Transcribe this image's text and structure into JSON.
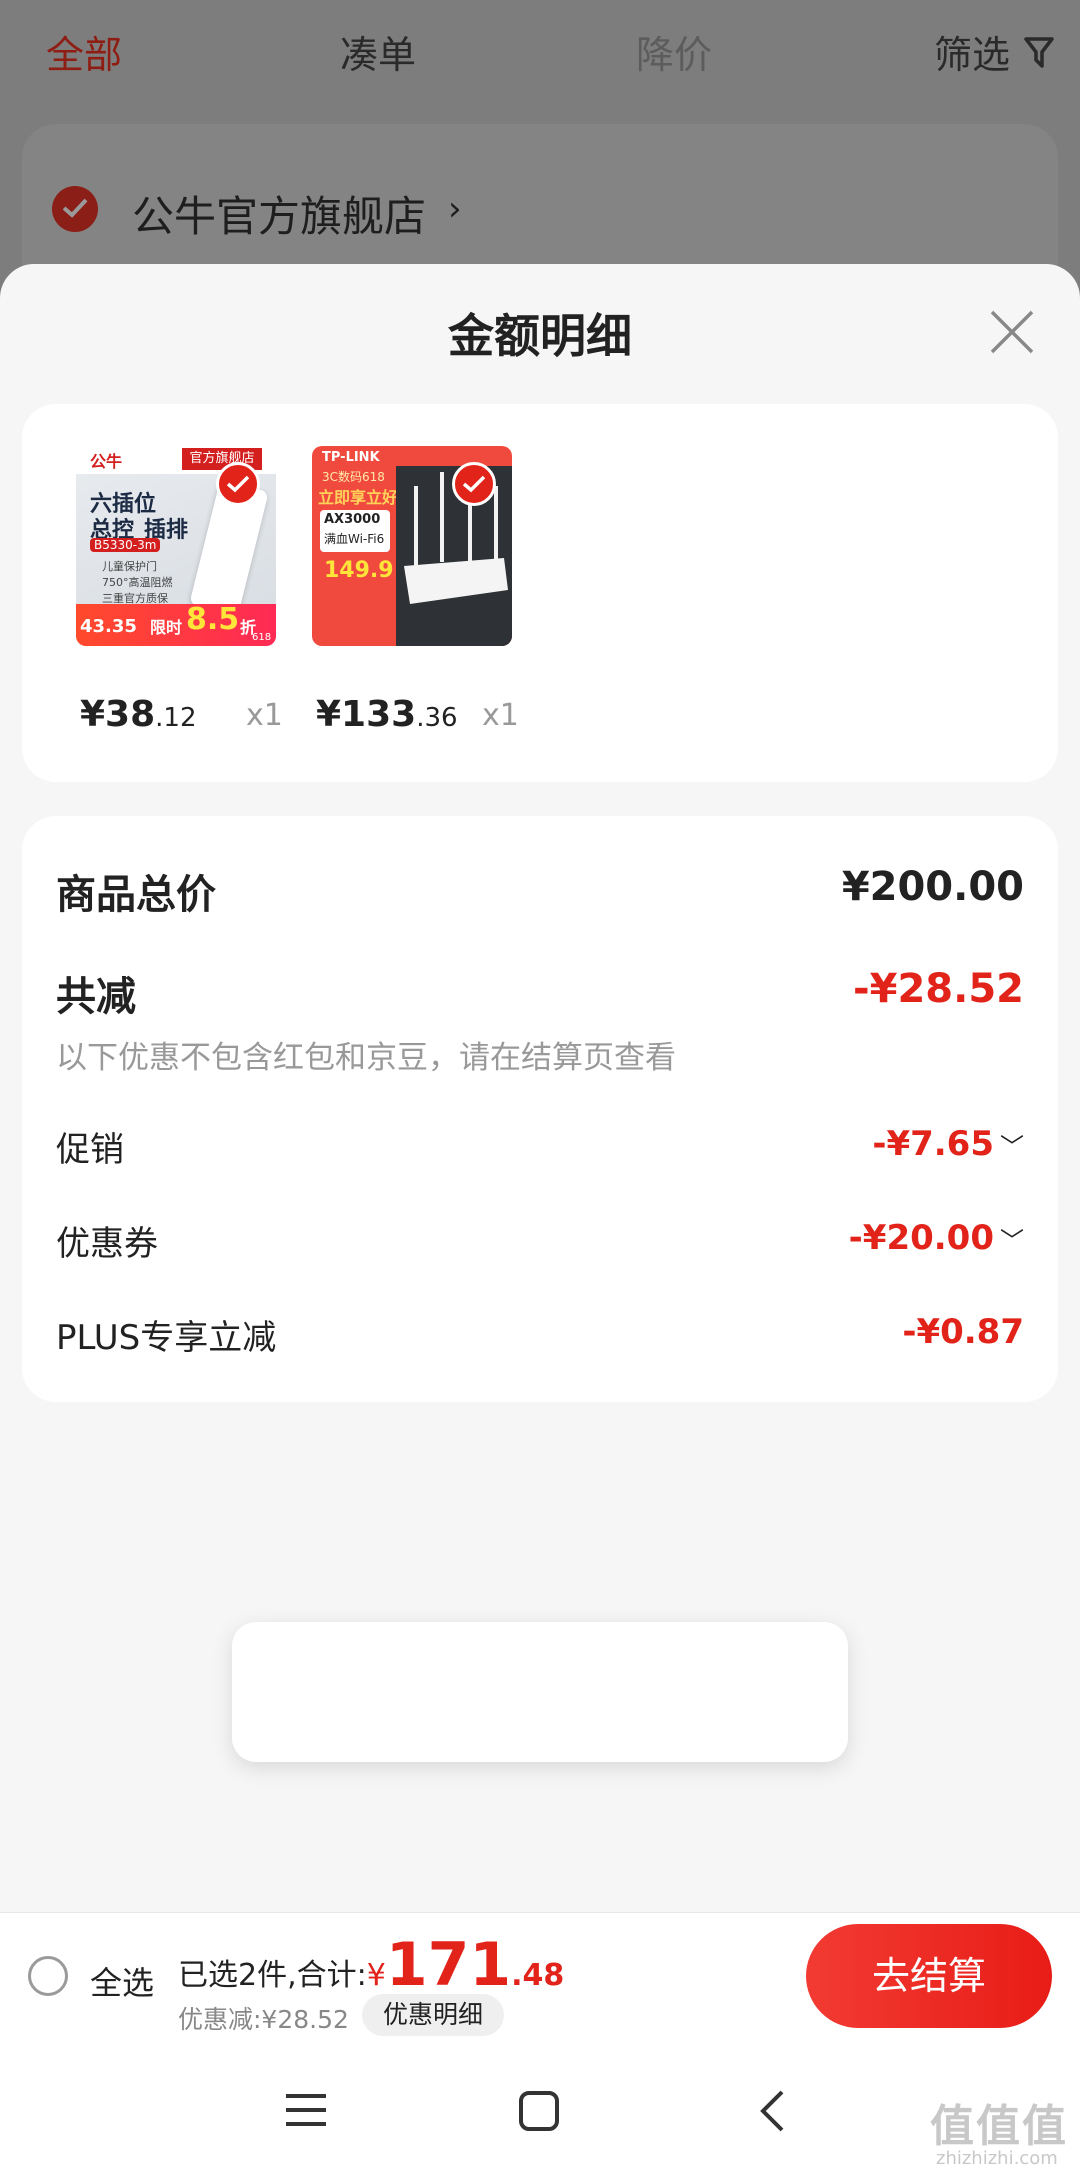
{
  "background_page": {
    "tabs": [
      "全部",
      "凑单",
      "降价",
      "筛选"
    ],
    "store_name": "公牛官方旗舰店",
    "store_chevron": "›"
  },
  "sheet": {
    "title": "金额明细",
    "items": [
      {
        "thumb": {
          "brand": "公牛",
          "store_tag": "官方旗舰店",
          "line1": "六插位",
          "line2": "总控",
          "line3": "插排",
          "model": "B5330-3m",
          "feat1": "儿童保护门",
          "feat2": "750°高温阻燃",
          "feat3": "三重官方质保",
          "promo_label": "限时",
          "promo_num": "8.5",
          "promo_unit": "折",
          "price_tag": "43.35",
          "badge": "618"
        },
        "price_int": "¥38",
        "price_dec": ".12",
        "qty": "x1"
      },
      {
        "thumb": {
          "brand": "TP-LINK",
          "campaign": "3C数码618",
          "headline": "立即享立好",
          "model": "AX3000",
          "subtitle": "满血Wi-Fi6",
          "price_tag": "149.9"
        },
        "price_int": "¥133",
        "price_dec": ".36",
        "qty": "x1"
      }
    ],
    "summary": {
      "total_label": "商品总价",
      "total_value": "¥200.00",
      "reduce_label": "共减",
      "reduce_value": "-¥28.52",
      "note": "以下优惠不包含红包和京豆，请在结算页查看",
      "rows": [
        {
          "label": "促销",
          "value": "-¥7.65",
          "chevron": "﹀"
        },
        {
          "label": "优惠券",
          "value": "-¥20.00",
          "chevron": "﹀"
        },
        {
          "label": "PLUS专享立减",
          "value": "-¥0.87",
          "chevron": ""
        }
      ]
    }
  },
  "bottom_bar": {
    "select_all": "全选",
    "selected_prefix": "已选2件,合计:",
    "currency": "¥",
    "total_int": "171",
    "total_dec": ".48",
    "discount": "优惠减:¥28.52",
    "detail_button": "优惠明细",
    "checkout": "去结算"
  },
  "watermark": {
    "text": "值值值",
    "sub": "zhizhizhi.com"
  },
  "colors": {
    "accent": "#e2231a",
    "sheet_bg": "#f6f6f6",
    "dim_overlay": "#7d7d7d"
  }
}
